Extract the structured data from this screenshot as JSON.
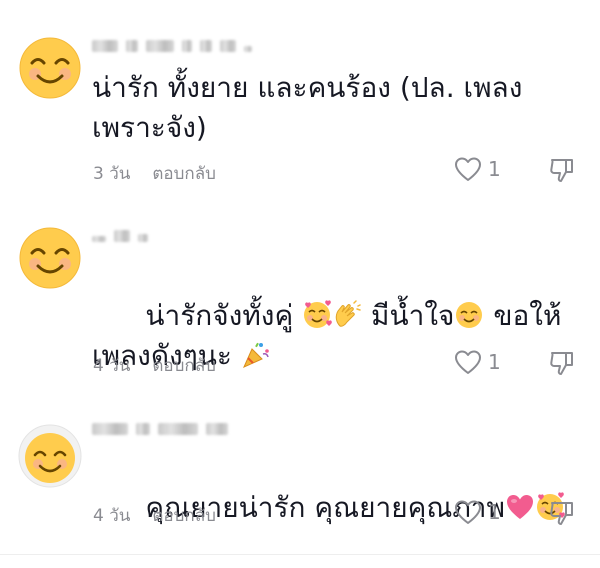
{
  "comments": [
    {
      "text": "น่ารัก ทั้งยาย และคนร้อง (ปล. เพลง\nเพราะจัง)",
      "time": "3 วัน",
      "reply_label": "ตอบกลับ",
      "likes": "1",
      "avatar_icon": "smiling-face-emoji"
    },
    {
      "text_part1": "น่ารักจังทั้งคู่ ",
      "text_part2": " มีน้ำใจ",
      "text_part3": " ขอให้\nเพลงดังๆนะ ",
      "time": "4 วัน",
      "reply_label": "ตอบกลับ",
      "likes": "1",
      "avatar_icon": "smiling-face-emoji",
      "inline_emojis": [
        "smiling-face-with-hearts",
        "clapping-hands",
        "smiling-face",
        "party-popper"
      ]
    },
    {
      "text": "คุณยายน่ารัก คุณยายคุณภาพ",
      "time": "4 วัน",
      "reply_label": "ตอบกลับ",
      "likes": "1",
      "avatar_icon": "smiling-face-emoji",
      "inline_emojis": [
        "pink-heart",
        "smiling-face-with-hearts"
      ]
    }
  ],
  "colors": {
    "text": "#161823",
    "meta": "#8a8b91",
    "emoji_yellow": "#FFCC4D",
    "heart": "#F25C8F"
  }
}
